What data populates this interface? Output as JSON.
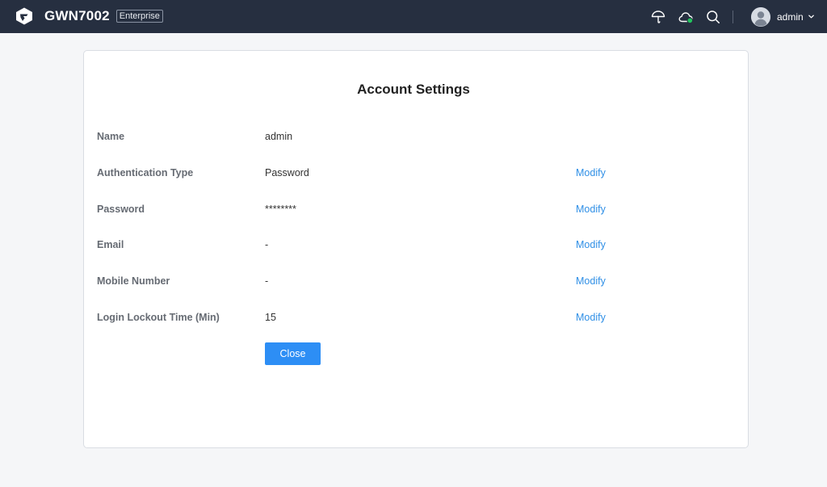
{
  "header": {
    "product": "GWN7002",
    "edition": "Enterprise",
    "icons": [
      "grandstream-logo-icon",
      "umbrella-icon",
      "cloud-status-icon",
      "search-icon"
    ],
    "user": {
      "name": "admin",
      "icon": "user-avatar-icon",
      "menu_icon": "chevron-down-icon"
    }
  },
  "account_settings": {
    "title": "Account Settings",
    "rows": [
      {
        "label": "Name",
        "value": "admin",
        "action": ""
      },
      {
        "label": "Authentication Type",
        "value": "Password",
        "action": "Modify"
      },
      {
        "label": "Password",
        "value": "********",
        "action": "Modify"
      },
      {
        "label": "Email",
        "value": "-",
        "action": "Modify"
      },
      {
        "label": "Mobile Number",
        "value": "-",
        "action": "Modify"
      },
      {
        "label": "Login Lockout Time (Min)",
        "value": "15",
        "action": "Modify"
      }
    ],
    "close_label": "Close"
  },
  "colors": {
    "topbar": "#262f40",
    "link": "#2f8fe6",
    "primary_button": "#2d8ef5",
    "cloud_ok": "#22c55e"
  }
}
